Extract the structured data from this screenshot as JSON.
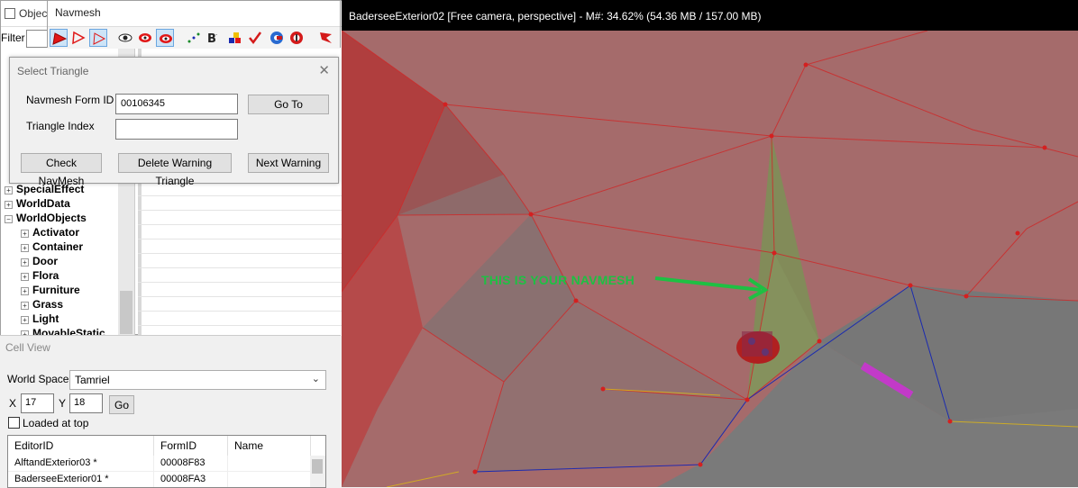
{
  "object_window": {
    "title": "Objec",
    "filter_label": "Filter",
    "tree_items": [
      {
        "label": "SpecialEffect"
      },
      {
        "label": "WorldData"
      },
      {
        "label": "WorldObjects"
      },
      {
        "label": "Activator"
      },
      {
        "label": "Container"
      },
      {
        "label": "Door"
      },
      {
        "label": "Flora"
      },
      {
        "label": "Furniture"
      },
      {
        "label": "Grass"
      },
      {
        "label": "Light"
      },
      {
        "label": "MovableStatic"
      }
    ]
  },
  "navmesh_window": {
    "title": "Navmesh",
    "toolbar_icons": [
      "select-triangle-icon",
      "select-edge-icon",
      "select-vertex-icon",
      "eye-icon",
      "hide-icon",
      "show-hidden-icon",
      "dots-icon",
      "bold-b-icon",
      "color-palette-icon",
      "check-icon",
      "find-cover-icon",
      "warning-icon",
      "flag-icon"
    ]
  },
  "select_triangle": {
    "title": "Select Triangle",
    "close_glyph": "✕",
    "navmesh_form_id_label": "Navmesh Form ID",
    "navmesh_form_id_value": "00106345",
    "triangle_index_label": "Triangle Index",
    "triangle_index_value": "",
    "goto_button": "Go To",
    "check_navmesh_button": "Check NavMesh",
    "delete_warning_button": "Delete Warning Triangle",
    "next_warning_button": "Next Warning"
  },
  "cell_view": {
    "title": "Cell View",
    "world_space_label": "World Space",
    "world_space_value": "Tamriel",
    "x_label": "X",
    "x_value": "17",
    "y_label": "Y",
    "y_value": "18",
    "go_button": "Go",
    "loaded_at_top_label": "Loaded at top",
    "columns": [
      "EditorID",
      "FormID",
      "Name"
    ],
    "rows": [
      {
        "editor_id": "AlftandExterior03 *",
        "form_id": "00008F83",
        "name": ""
      },
      {
        "editor_id": "BaderseeExterior01 *",
        "form_id": "00008FA3",
        "name": ""
      }
    ]
  },
  "viewport": {
    "title": "BaderseeExterior02 [Free camera, perspective] - M#: 34.62% (54.36 MB / 157.00 MB)",
    "annotation": "THIS IS YOUR NAVMESH",
    "colors": {
      "navmesh_fill": "#a56666",
      "selected_triangle": "#7f8d59",
      "edge": "#d42a2a",
      "boundary_blue": "#1a2ab0",
      "annotation": "#1ec043",
      "marker": "#c23ac8"
    }
  }
}
